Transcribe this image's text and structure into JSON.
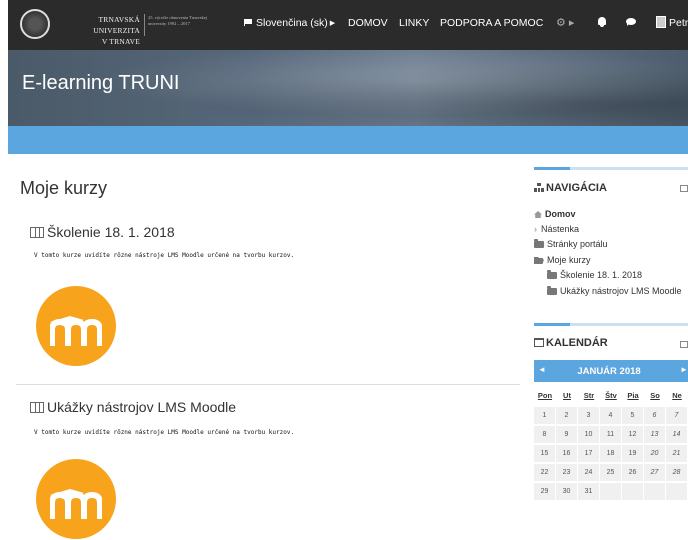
{
  "navbar": {
    "university_line1": "TRNAVSKÁ UNIVERZITA",
    "university_line2": "V TRNAVE",
    "university_subtitle": "25. výročie obnovenia Trnavskej univerzity 1992 – 2017",
    "language": "Slovenčina (sk)",
    "links": [
      "DOMOV",
      "LINKY",
      "PODPORA A POMOC"
    ],
    "user": "Petr"
  },
  "header": {
    "site_title": "E-learning TRUNI"
  },
  "main": {
    "page_title": "Moje kurzy",
    "courses": [
      {
        "title": "Školenie 18. 1. 2018",
        "description": "V tomto kurze uvidíte rôzne nástroje LMS Moodle určené na tvorbu kurzov."
      },
      {
        "title": "Ukážky nástrojov LMS Moodle",
        "description": "V tomto kurze uvidíte rôzne nástroje LMS Moodle určené na tvorbu kurzov."
      }
    ]
  },
  "navigation_block": {
    "title": "NAVIGÁCIA",
    "items": [
      {
        "label": "Domov",
        "icon": "home-icon"
      },
      {
        "label": "Nástenka",
        "icon": "chevron-right-icon"
      },
      {
        "label": "Stránky portálu",
        "icon": "folder-icon"
      },
      {
        "label": "Moje kurzy",
        "icon": "folder-open-icon"
      },
      {
        "label": "Školenie 18. 1. 2018",
        "icon": "folder-icon"
      },
      {
        "label": "Ukážky nástrojov LMS Moodle",
        "icon": "folder-icon"
      }
    ]
  },
  "calendar_block": {
    "title": "KALENDÁR",
    "month": "JANUÁR 2018",
    "prev": "◄",
    "next": "►",
    "weekdays": [
      "Pon",
      "Ut",
      "Str",
      "Štv",
      "Pia",
      "So",
      "Ne"
    ],
    "weeks": [
      [
        "1",
        "2",
        "3",
        "4",
        "5",
        "6",
        "7"
      ],
      [
        "8",
        "9",
        "10",
        "11",
        "12",
        "13",
        "14"
      ],
      [
        "15",
        "16",
        "17",
        "18",
        "19",
        "20",
        "21"
      ],
      [
        "22",
        "23",
        "24",
        "25",
        "26",
        "27",
        "28"
      ],
      [
        "29",
        "30",
        "31",
        "",
        "",
        "",
        ""
      ]
    ]
  },
  "colors": {
    "navbar": "#2b2b2b",
    "accent_blue": "#5ba6df",
    "moodle_orange": "#f7a31c"
  }
}
